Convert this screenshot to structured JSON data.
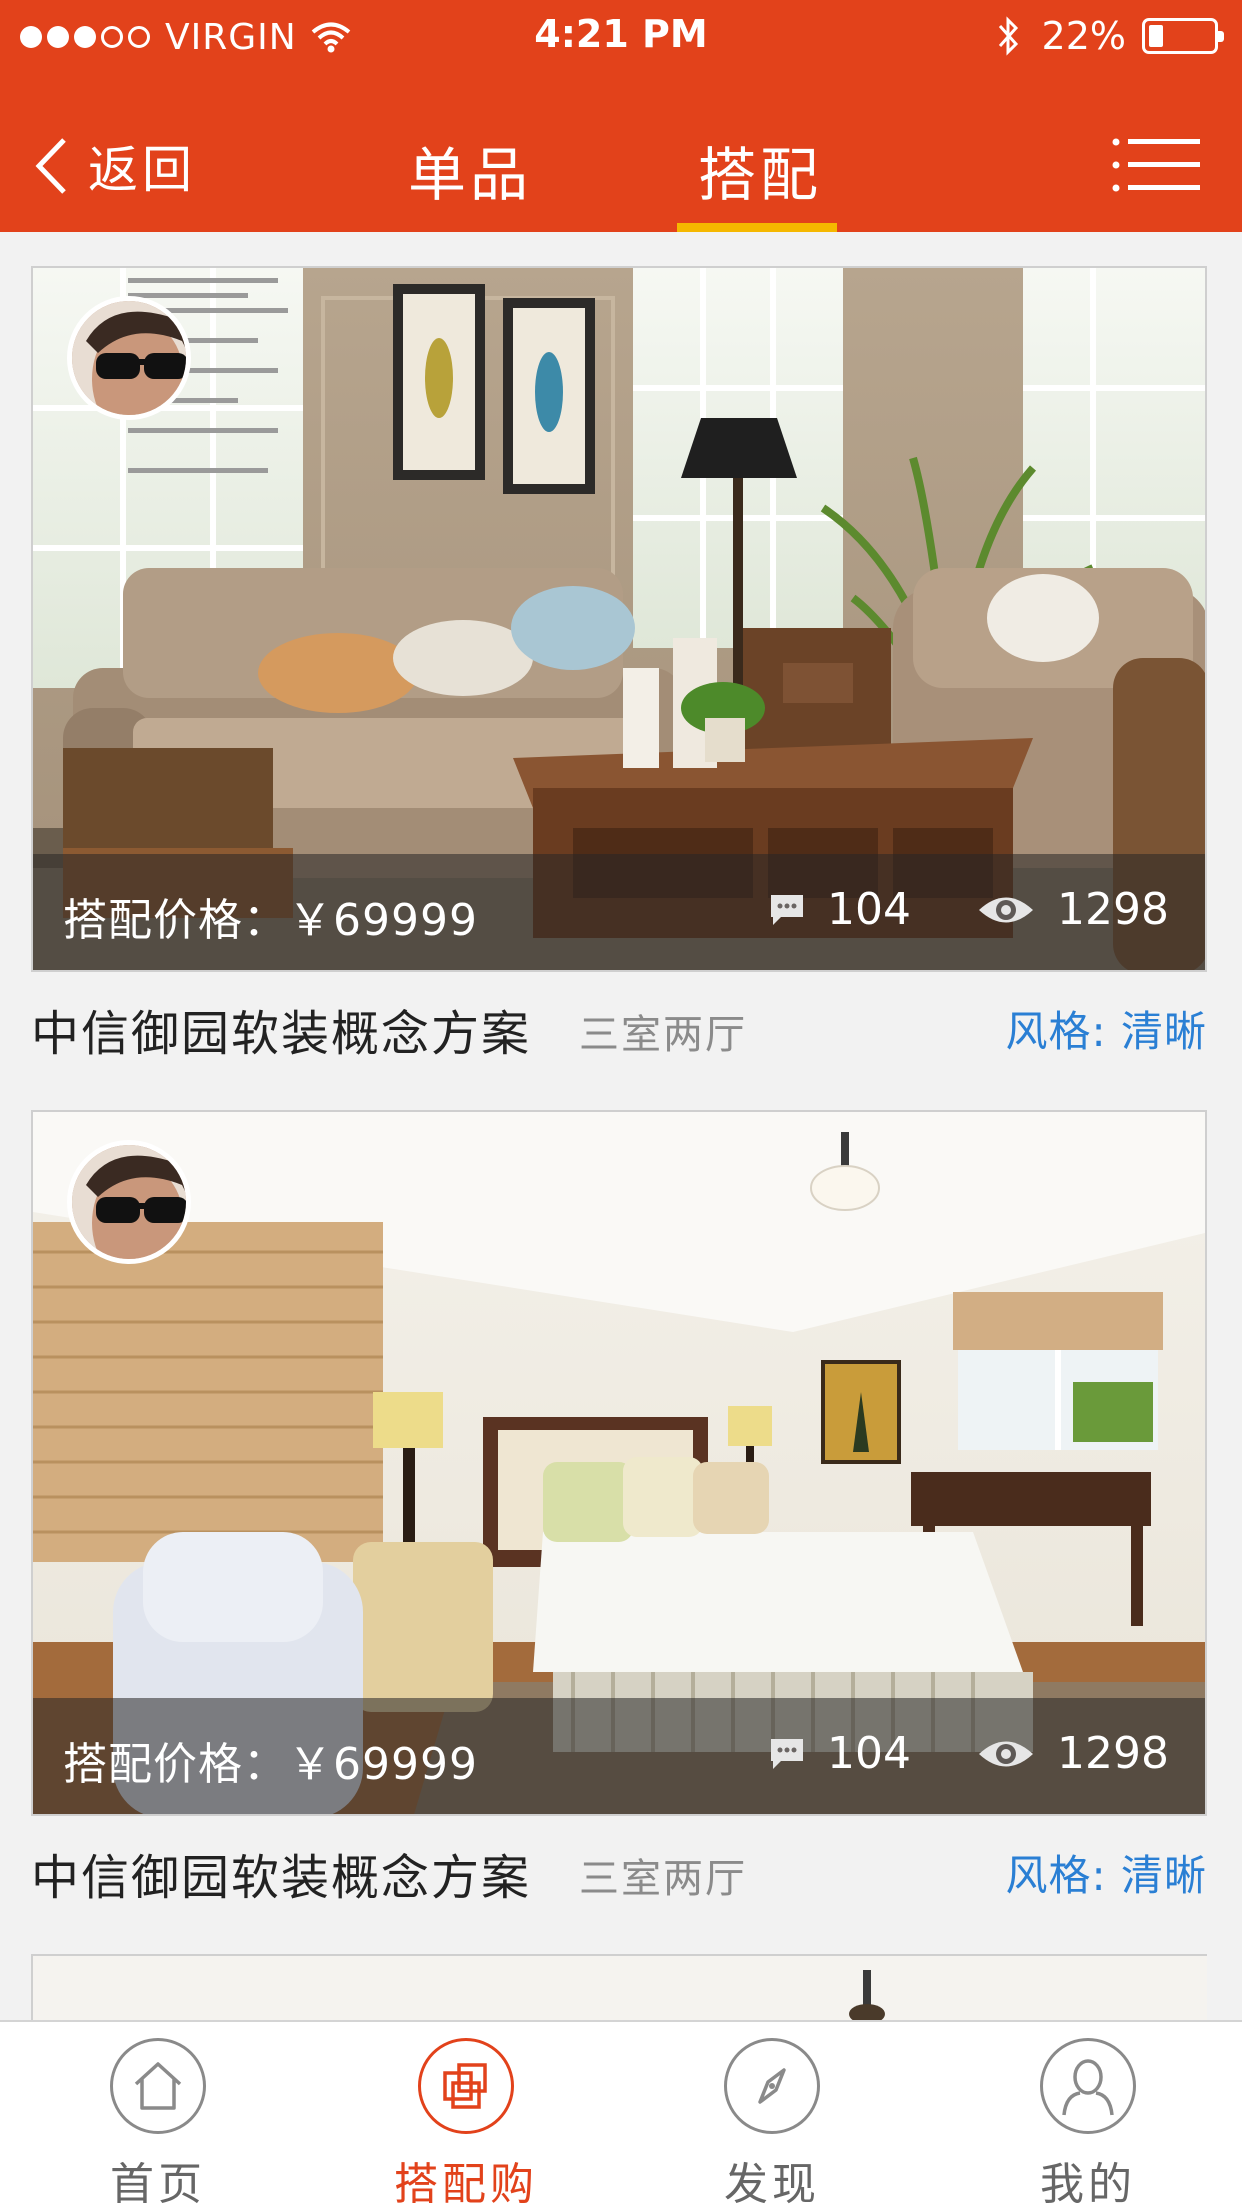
{
  "status_bar": {
    "carrier": "VIRGIN",
    "time": "4:21 PM",
    "battery": "22%",
    "battery_level": 0.22
  },
  "nav": {
    "back_label": "返回",
    "tabs": [
      {
        "label": "单品",
        "active": false
      },
      {
        "label": "搭配",
        "active": true
      }
    ],
    "menu_icon": "menu-icon"
  },
  "cards": [
    {
      "price": "搭配价格：￥69999",
      "comments": "104",
      "views": "1298",
      "title": "中信御园软装概念方案",
      "subtitle": "三室两厅",
      "style": "风格: 清晰"
    },
    {
      "price": "搭配价格：￥69999",
      "comments": "104",
      "views": "1298",
      "title": "中信御园软装概念方案",
      "subtitle": "三室两厅",
      "style": "风格: 清晰"
    }
  ],
  "tabbar": [
    {
      "label": "首页",
      "icon": "home-icon",
      "active": false
    },
    {
      "label": "搭配购",
      "icon": "collage-icon",
      "active": true
    },
    {
      "label": "发现",
      "icon": "compass-icon",
      "active": false
    },
    {
      "label": "我的",
      "icon": "user-icon",
      "active": false
    }
  ],
  "colors": {
    "brand": "#e2421b",
    "tab_indicator": "#f5b800",
    "style_link": "#2a7fd4"
  }
}
